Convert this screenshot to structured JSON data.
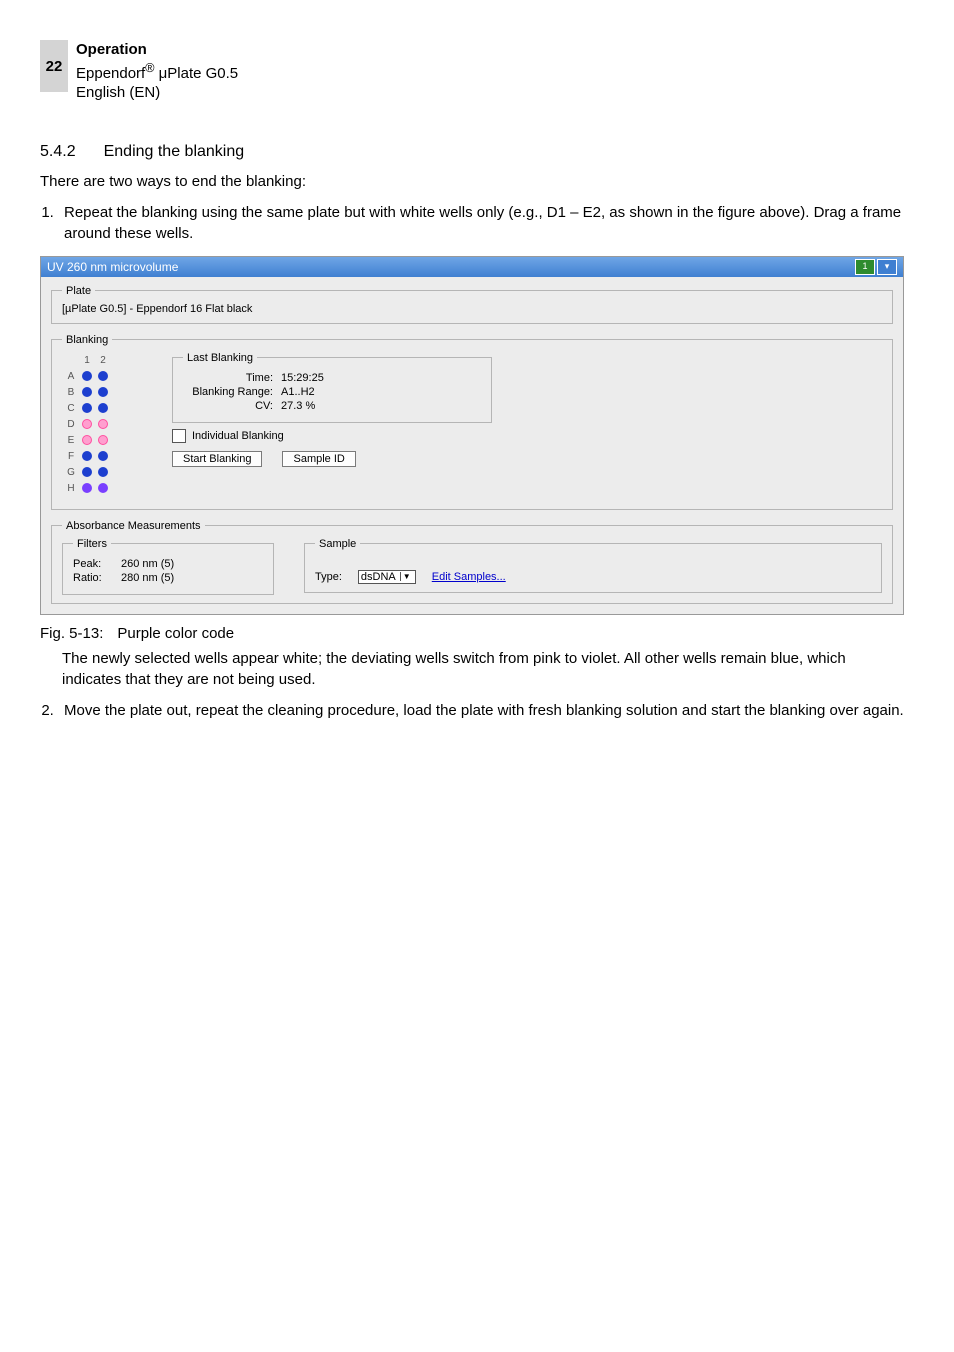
{
  "page_number": "22",
  "header": {
    "bold_line": "Operation",
    "line2_pre": "Eppendorf",
    "line2_reg": "®",
    "line2_post": " μPlate G0.5",
    "line3": "English (EN)"
  },
  "section": {
    "num": "5.4.2",
    "title": "Ending the blanking"
  },
  "intro": "There are two ways to end the blanking:",
  "steps": {
    "s1": "Repeat the blanking using the same plate but with white wells only (e.g., D1 – E2, as shown in the figure above). Drag a frame around these wells.",
    "s2": "Move the plate out, repeat the cleaning procedure, load the plate with fresh blanking solution and start the blanking over again."
  },
  "fig": {
    "label": "Fig. 5-13:",
    "caption": "Purple color code"
  },
  "after_fig": {
    "p1": "The newly selected wells appear white; the deviating wells switch from pink to violet. All other wells remain blue, which indicates that they are not being used.",
    "p2": ""
  },
  "app": {
    "title": "UV 260 nm microvolume",
    "title_btn1": "1",
    "title_btn2": "▾",
    "plate_legend": "Plate",
    "plate_desc": "[µPlate G0.5] - Eppendorf 16 Flat black",
    "blanking_legend": "Blanking",
    "wells": {
      "cols": [
        "1",
        "2"
      ],
      "rows": [
        "A",
        "B",
        "C",
        "D",
        "E",
        "F",
        "G",
        "H"
      ],
      "states": {
        "A": [
          "blue",
          "blue"
        ],
        "B": [
          "blue",
          "blue"
        ],
        "C": [
          "blue",
          "blue"
        ],
        "D": [
          "pink",
          "pink"
        ],
        "E": [
          "pink",
          "pink"
        ],
        "F": [
          "blue",
          "blue"
        ],
        "G": [
          "blue",
          "blue"
        ],
        "H": [
          "violet",
          "violet"
        ]
      }
    },
    "last_blanking_legend": "Last Blanking",
    "lb_time_k": "Time:",
    "lb_time_v": "15:29:25",
    "lb_range_k": "Blanking Range:",
    "lb_range_v": "A1..H2",
    "lb_cv_k": "CV:",
    "lb_cv_v": "27.3 %",
    "individual_blanking": "Individual Blanking",
    "start_blanking_btn": "Start Blanking",
    "sample_id_btn": "Sample ID",
    "absorbance_legend": "Absorbance Measurements",
    "filters_legend": "Filters",
    "peak_k": "Peak:",
    "peak_v": "260 nm (5)",
    "ratio_k": "Ratio:",
    "ratio_v": "280 nm (5)",
    "sample_legend": "Sample",
    "type_k": "Type:",
    "type_sel": "dsDNA",
    "edit_samples": "Edit Samples..."
  }
}
